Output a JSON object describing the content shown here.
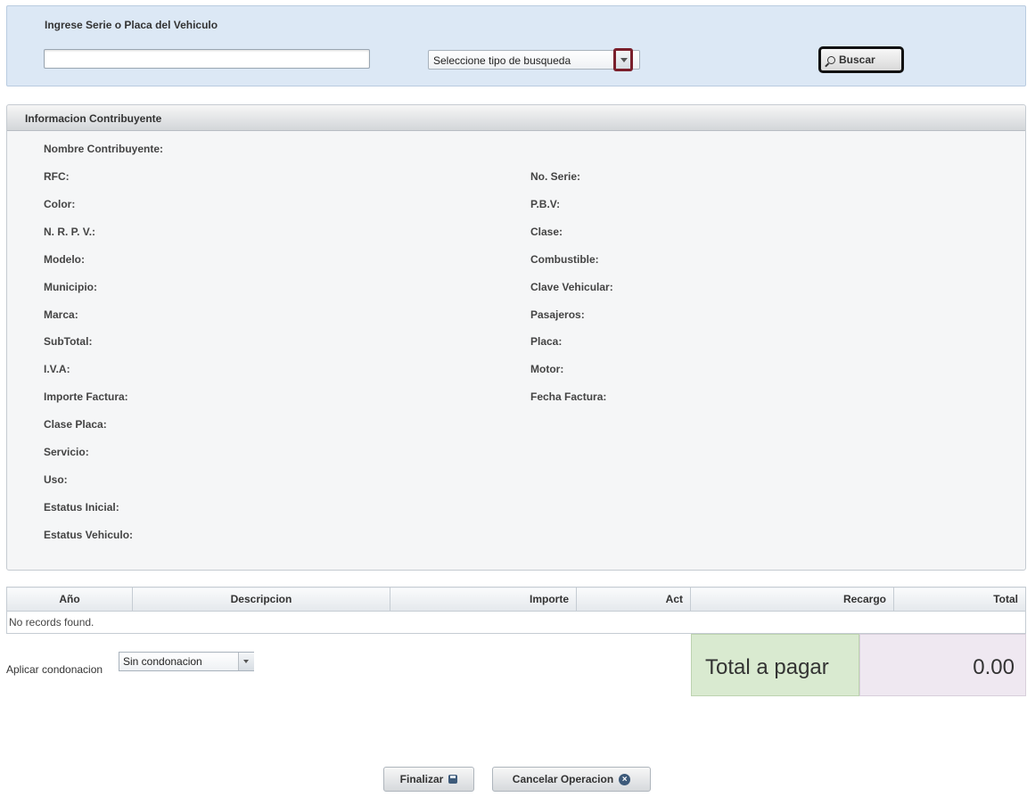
{
  "search": {
    "label": "Ingrese Serie o Placa del Vehiculo",
    "input_value": "",
    "type_select": "Seleccione tipo de busqueda",
    "button_label": "Buscar"
  },
  "info": {
    "title": "Informacion Contribuyente",
    "nombre": "Nombre Contribuyente:",
    "left_fields": [
      "RFC:",
      "Color:",
      "N. R. P. V.:",
      "Modelo:",
      "Municipio:",
      "Marca:",
      "SubTotal:",
      "I.V.A:",
      "Importe Factura:",
      "Clase Placa:",
      "Servicio:",
      "Uso:",
      "Estatus Inicial:",
      "Estatus Vehiculo:"
    ],
    "right_fields": [
      "No. Serie:",
      "P.B.V:",
      "Clase:",
      "Combustible:",
      "Clave Vehicular:",
      "Pasajeros:",
      "Placa:",
      "Motor:",
      "Fecha Factura:"
    ]
  },
  "table": {
    "columns": [
      "Año",
      "Descripcion",
      "Importe",
      "Act",
      "Recargo",
      "Total"
    ],
    "empty_message": "No records found."
  },
  "condonacion": {
    "label": "Aplicar condonacion",
    "selected": "Sin condonacion"
  },
  "total": {
    "label": "Total a pagar",
    "value": "0.00"
  },
  "actions": {
    "finalizar": "Finalizar",
    "cancelar": "Cancelar Operacion"
  }
}
